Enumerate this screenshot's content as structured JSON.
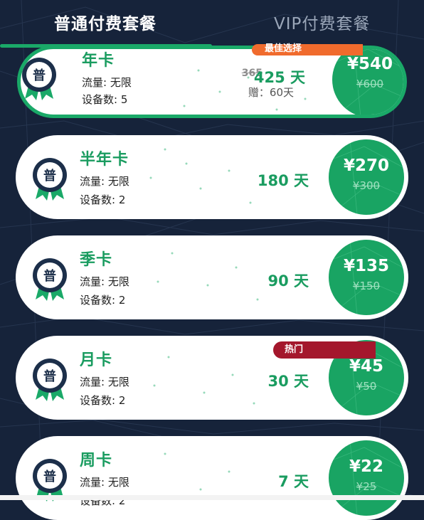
{
  "tabs": [
    {
      "label": "普通付费套餐",
      "active": true
    },
    {
      "label": "VIP付费套餐",
      "active": false
    }
  ],
  "colors": {
    "background": "#16233a",
    "accent": "#1aa968",
    "best_ribbon": "#f06b2d",
    "hot_ribbon": "#a4172c"
  },
  "plans": [
    {
      "badge_text": "普",
      "name": "年卡",
      "traffic": "流量: 无限",
      "devices": "设备数: 5",
      "days_old": "365",
      "days": "425 天",
      "bonus": "赠：60天",
      "price": "¥540",
      "price_old": "¥600",
      "ribbon": "最佳选择",
      "selected": true
    },
    {
      "badge_text": "普",
      "name": "半年卡",
      "traffic": "流量: 无限",
      "devices": "设备数: 2",
      "days": "180 天",
      "price": "¥270",
      "price_old": "¥300"
    },
    {
      "badge_text": "普",
      "name": "季卡",
      "traffic": "流量: 无限",
      "devices": "设备数: 2",
      "days": "90 天",
      "price": "¥135",
      "price_old": "¥150"
    },
    {
      "badge_text": "普",
      "name": "月卡",
      "traffic": "流量: 无限",
      "devices": "设备数: 2",
      "days": "30 天",
      "price": "¥45",
      "price_old": "¥50",
      "ribbon": "热门"
    },
    {
      "badge_text": "普",
      "name": "周卡",
      "traffic": "流量: 无限",
      "devices": "设备数: 2",
      "days": "7 天",
      "price": "¥22",
      "price_old": "¥25"
    }
  ]
}
